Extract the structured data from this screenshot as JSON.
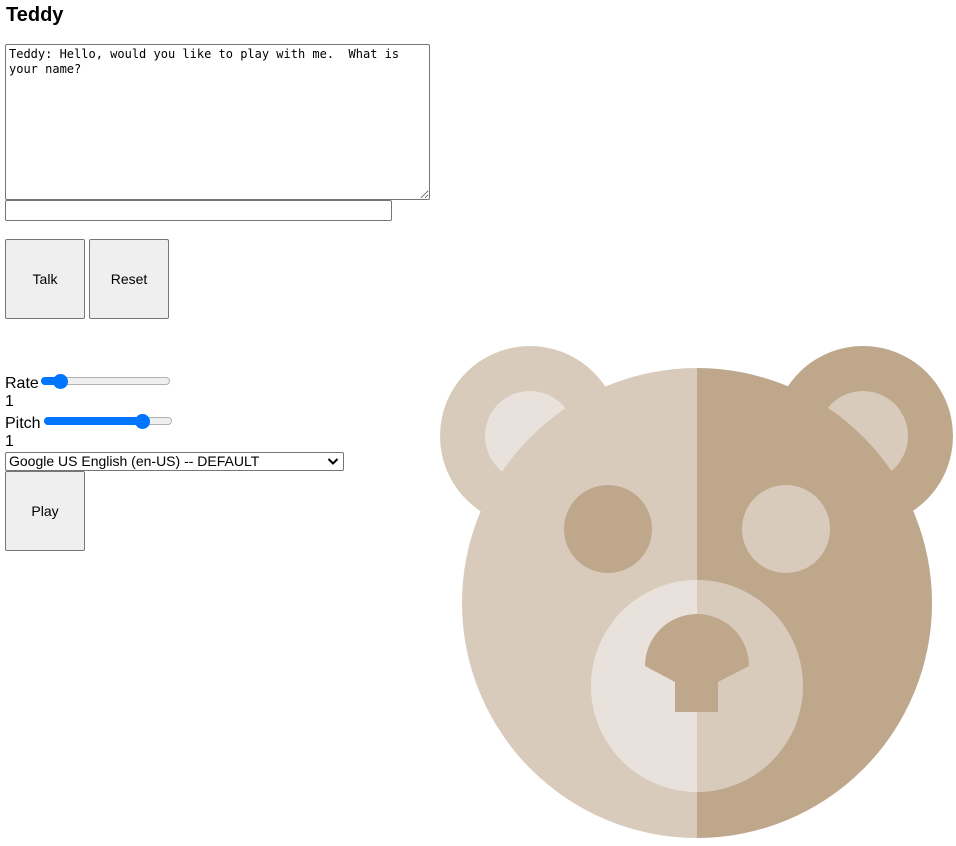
{
  "page": {
    "title": "Teddy"
  },
  "chat": {
    "log": "Teddy: Hello, would you like to play with me.  What is your name?",
    "input_value": "",
    "input_placeholder": ""
  },
  "buttons": {
    "talk": "Talk",
    "reset": "Reset",
    "play": "Play"
  },
  "controls": {
    "rate_label": "Rate",
    "rate_value": "1",
    "rate_fraction": 0.1,
    "pitch_label": "Pitch",
    "pitch_value": "1",
    "pitch_fraction": 0.8,
    "voice_selected": "Google US English (en-US) -- DEFAULT"
  },
  "colors": {
    "slider_accent": "#0075ff",
    "bear_light": "#d9cbbc",
    "bear_dark": "#bfa78c",
    "bear_lightest": "#e9e2dc"
  },
  "icons": {
    "dropdown": "chevron-down-icon",
    "illustration": "teddy-bear-face"
  }
}
